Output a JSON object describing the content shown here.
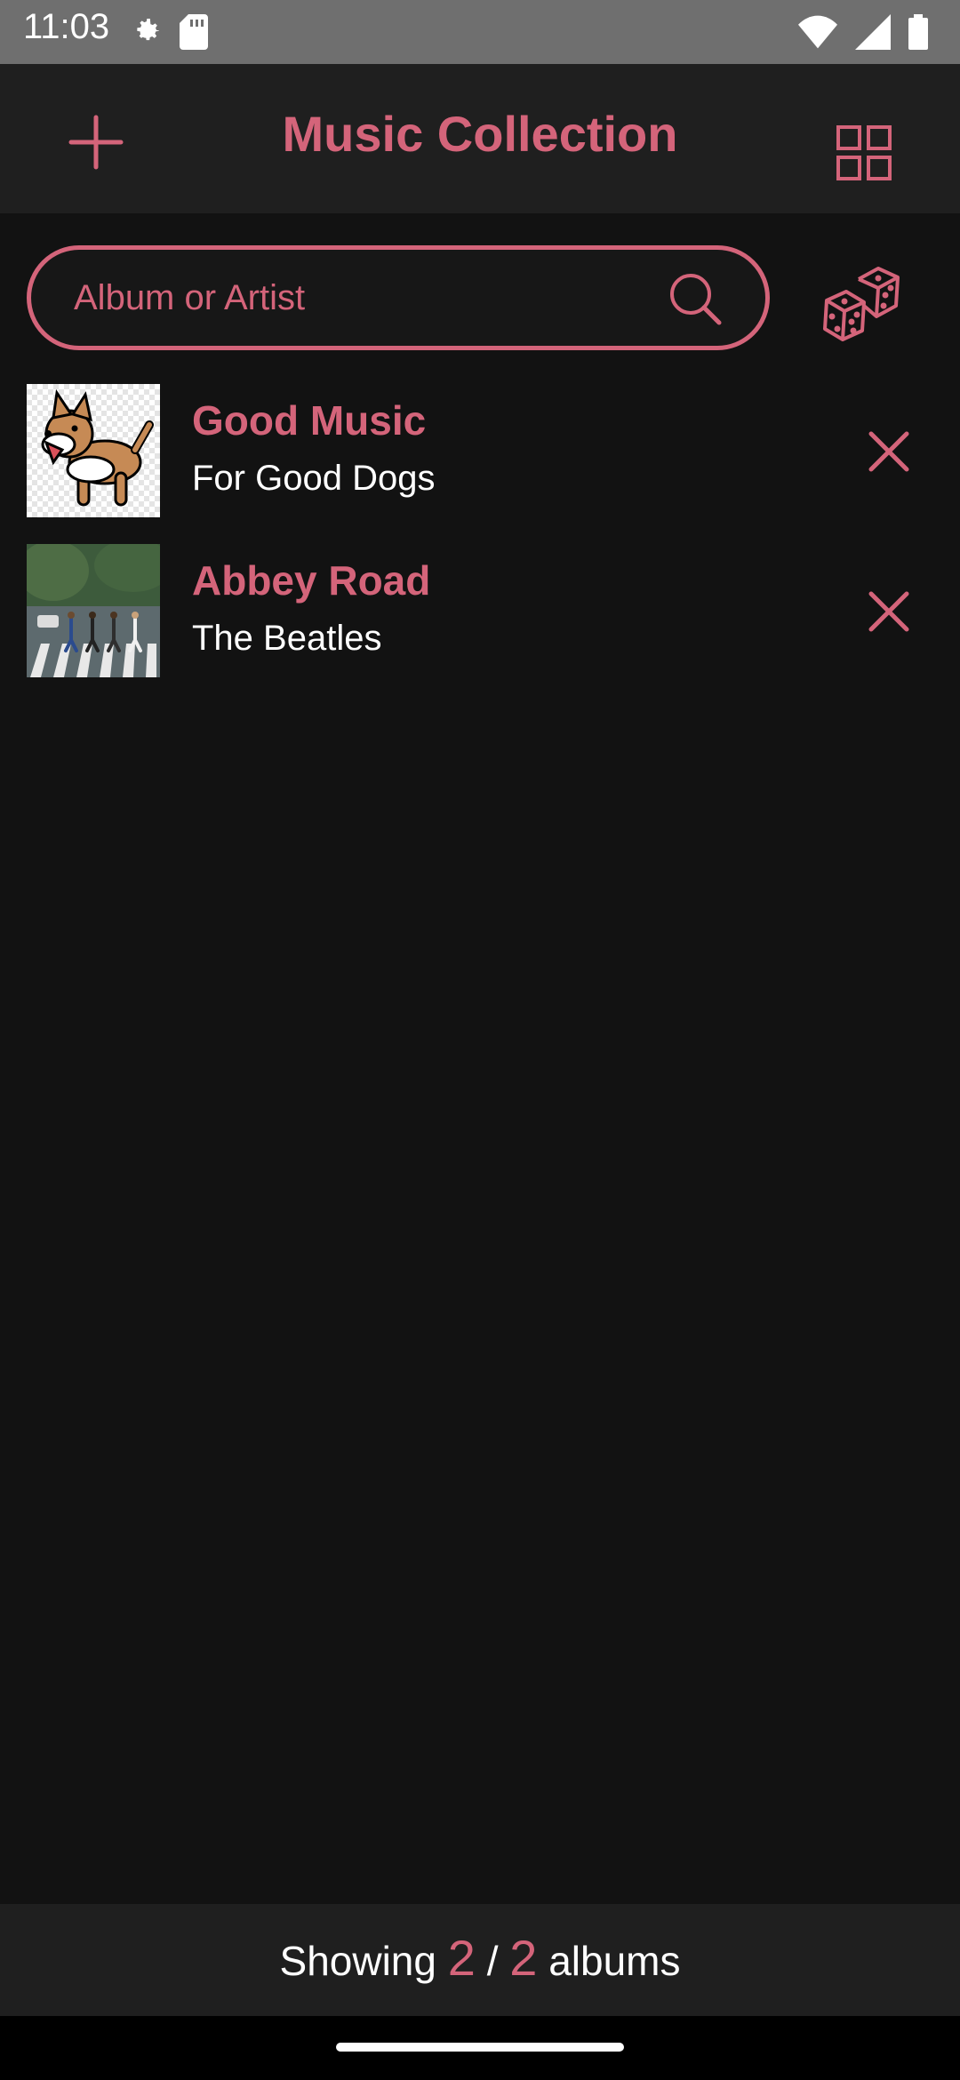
{
  "status_bar": {
    "time": "11:03",
    "left_icons": [
      "settings-icon",
      "sd-card-icon"
    ],
    "right_icons": [
      "wifi-icon",
      "signal-icon",
      "battery-icon"
    ]
  },
  "app_bar": {
    "title": "Music Collection",
    "add_icon": "plus-icon",
    "layout_icon": "grid-view-icon"
  },
  "search": {
    "placeholder": "Album or Artist",
    "value": "",
    "icon": "search-icon"
  },
  "random_icon": "dice-icon",
  "albums": [
    {
      "title": "Good Music",
      "artist": "For Good Dogs"
    },
    {
      "title": "Abbey Road",
      "artist": "The Beatles"
    }
  ],
  "footer": {
    "prefix": "Showing",
    "shown": "2",
    "separator": "/",
    "total": "2",
    "suffix": "albums"
  },
  "colors": {
    "accent": "#d4647a",
    "background": "#121212",
    "bar": "#1f1f1f"
  }
}
